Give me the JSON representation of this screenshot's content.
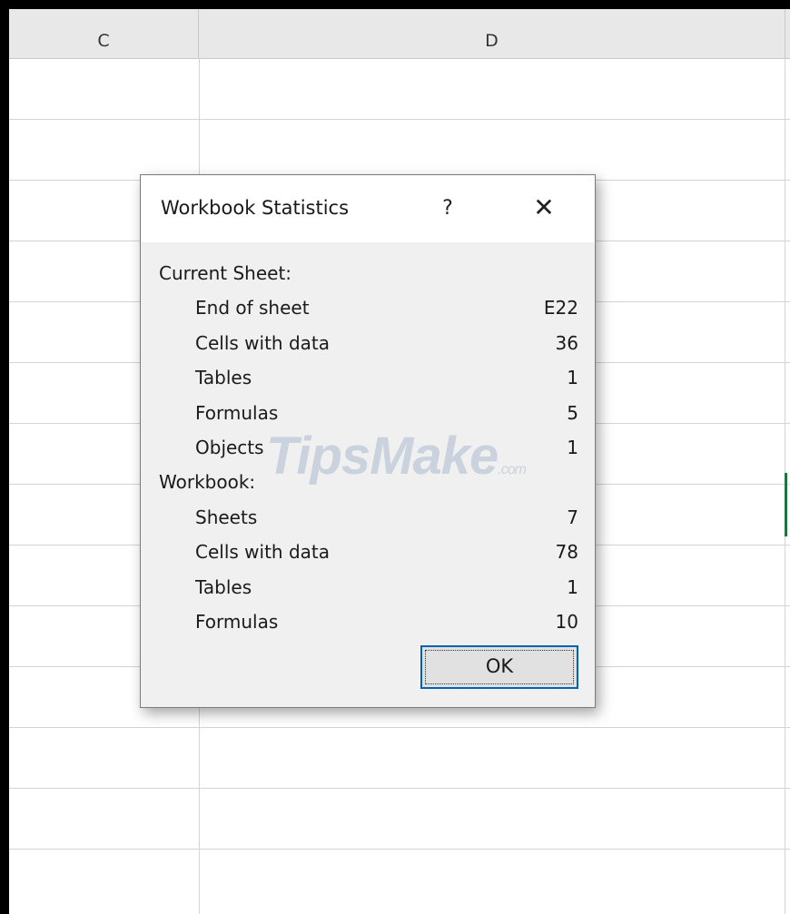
{
  "columns": [
    "C",
    "D"
  ],
  "dialog": {
    "title": "Workbook Statistics",
    "help_label": "?",
    "close_label": "✕",
    "ok_label": "OK",
    "current_sheet": {
      "heading": "Current Sheet:",
      "rows": [
        {
          "label": "End of sheet",
          "value": "E22"
        },
        {
          "label": "Cells with data",
          "value": "36"
        },
        {
          "label": "Tables",
          "value": "1"
        },
        {
          "label": "Formulas",
          "value": "5"
        },
        {
          "label": "Objects",
          "value": "1"
        }
      ]
    },
    "workbook": {
      "heading": "Workbook:",
      "rows": [
        {
          "label": "Sheets",
          "value": "7"
        },
        {
          "label": "Cells with data",
          "value": "78"
        },
        {
          "label": "Tables",
          "value": "1"
        },
        {
          "label": "Formulas",
          "value": "10"
        }
      ]
    }
  },
  "watermark": {
    "text": "TipsMake",
    "suffix": ".com"
  },
  "colors": {
    "selection": "#217346",
    "ok_border": "#0063b1"
  }
}
